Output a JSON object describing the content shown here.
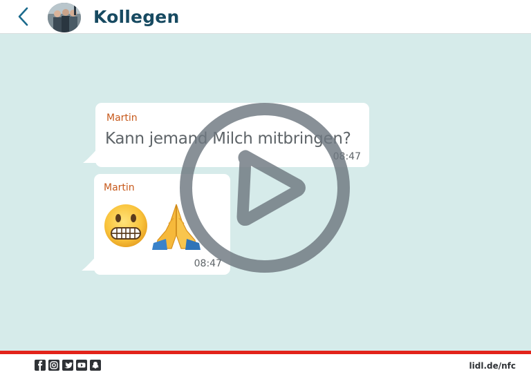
{
  "header": {
    "title": "Kollegen",
    "back_icon": "chevron-left-icon",
    "avatar": "group-avatar"
  },
  "messages": [
    {
      "sender": "Martin",
      "text": "Kann jemand Milch mitbringen?",
      "time": "08:47"
    },
    {
      "sender": "Martin",
      "emojis": [
        "grimacing-face-emoji",
        "folded-hands-emoji"
      ],
      "time": "08:47"
    }
  ],
  "overlay": {
    "icon": "play-icon"
  },
  "footer": {
    "social_icons": [
      "facebook-icon",
      "instagram-icon",
      "twitter-icon",
      "youtube-icon",
      "snapchat-icon"
    ],
    "link": "lidl.de/nfc"
  },
  "colors": {
    "title": "#174a61",
    "sender": "#c7591b",
    "chat_background": "#d6ebea",
    "footer_accent": "#e2231a"
  }
}
